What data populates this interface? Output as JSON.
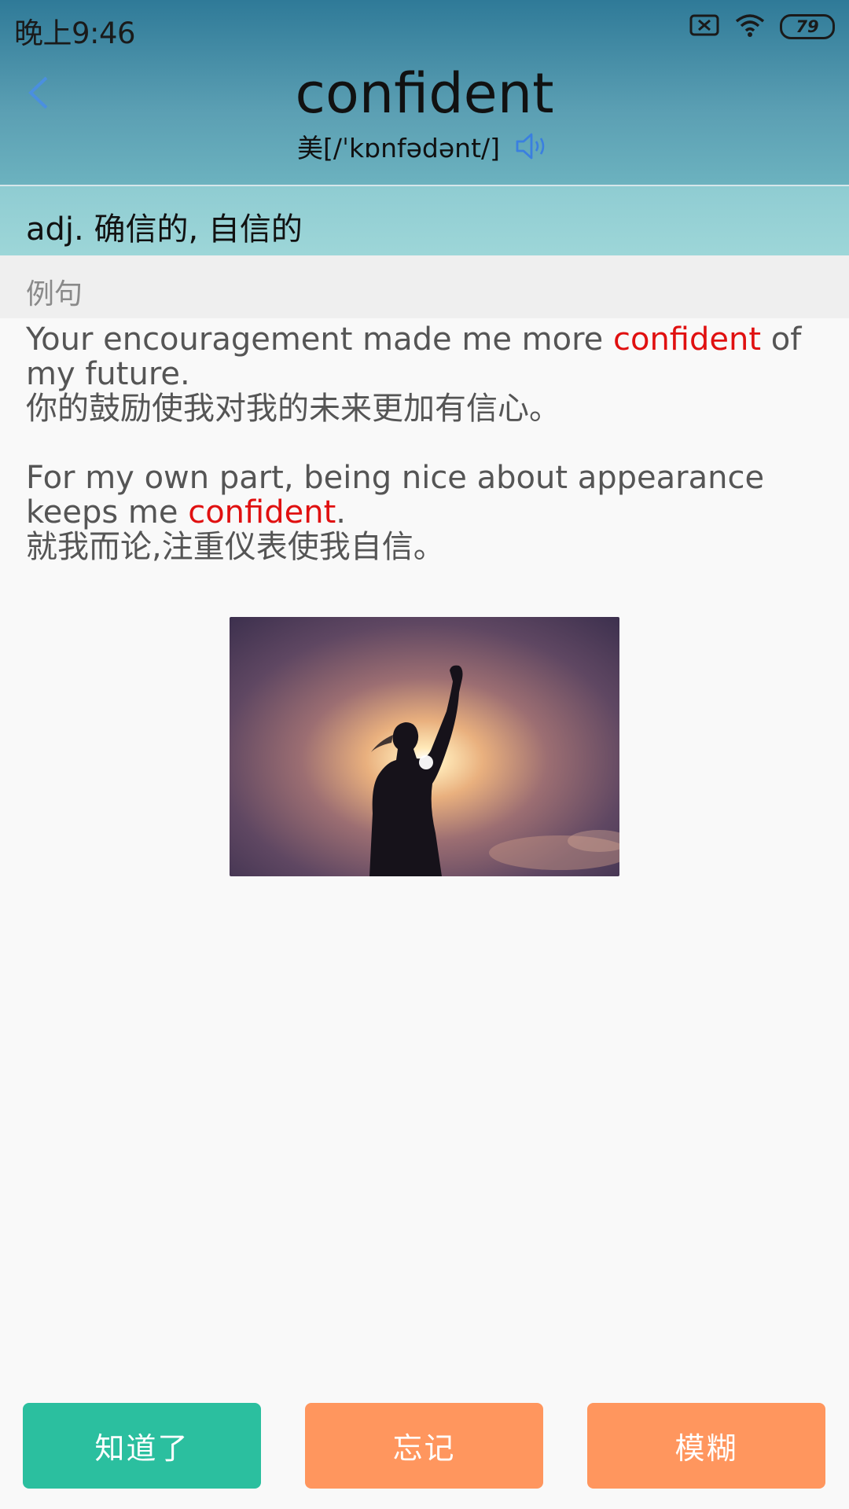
{
  "status_bar": {
    "time": "晚上9:46",
    "battery": "79",
    "icons": [
      "sim-x-icon",
      "wifi-icon",
      "battery-icon"
    ]
  },
  "word": {
    "title": "confident",
    "phonetic": "美[/ˈkɒnfədənt/]",
    "speaker_icon": "speaker-icon",
    "back_icon": "back-icon"
  },
  "definition": {
    "text": "adj. 确信的, 自信的"
  },
  "examples_section": {
    "title": "例句",
    "items": [
      {
        "en_before": "Your encouragement made me more ",
        "keyword": "confident",
        "en_after": " of my future.",
        "zh": "你的鼓励使我对我的未来更加有信心。"
      },
      {
        "en_before": "For my own part, being nice about appearance keeps me ",
        "keyword": "confident",
        "en_after": ".",
        "zh": "就我而论,注重仪表使我自信。"
      }
    ]
  },
  "image": {
    "subject": "silhouette-raised-fist-sunset"
  },
  "buttons": {
    "know": "知道了",
    "forget": "忘记",
    "blur": "模糊"
  },
  "colors": {
    "header_top": "#2f7a98",
    "definition_bg": "#9dd6d8",
    "keyword": "#e01010",
    "know_button": "#2bbf9f",
    "orange_button": "#ff965e",
    "back_icon": "#4a8fe0"
  }
}
